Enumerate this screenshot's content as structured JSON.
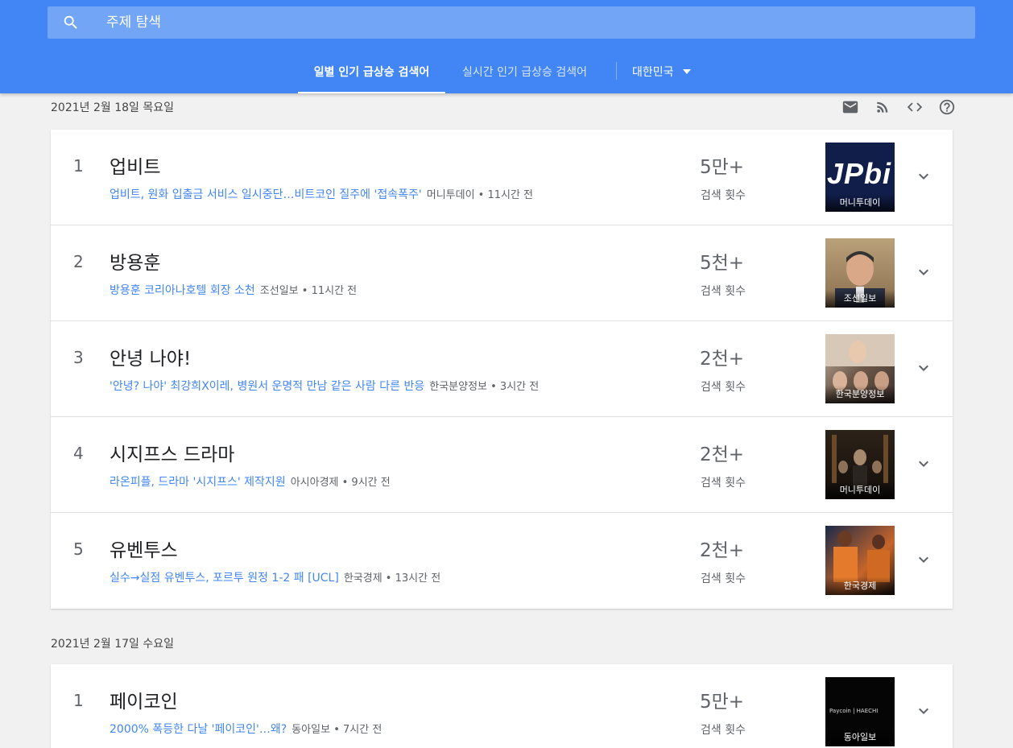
{
  "search": {
    "placeholder": "주제 탐색"
  },
  "tabs": {
    "daily": "일별 인기 급상승 검색어",
    "realtime": "실시간 인기 급상승 검색어"
  },
  "country": "대한민국",
  "days": [
    {
      "date": "2021년 2월 18일 목요일",
      "items": [
        {
          "rank": "1",
          "title": "업비트",
          "news": "업비트, 원화 입출금 서비스 일시중단…비트코인 질주에 '접속폭주'",
          "source": "머니투데이 • 11시간 전",
          "count": "5만+",
          "count_label": "검색 횟수",
          "thumb_caption": "머니투데이",
          "thumb_logo": "JPbi"
        },
        {
          "rank": "2",
          "title": "방용훈",
          "news": "방용훈 코리아나호텔 회장 소천",
          "source": "조선일보 • 11시간 전",
          "count": "5천+",
          "count_label": "검색 횟수",
          "thumb_caption": "조선일보"
        },
        {
          "rank": "3",
          "title": "안녕 나야!",
          "news": "'안녕? 나야' 최강희X이레, 병원서 운명적 만남 같은 사람 다른 반응",
          "source": "한국분양정보 • 3시간 전",
          "count": "2천+",
          "count_label": "검색 횟수",
          "thumb_caption": "한국분양정보"
        },
        {
          "rank": "4",
          "title": "시지프스 드라마",
          "news": "라온피플, 드라마 '시지프스' 제작지원",
          "source": "아시아경제 • 9시간 전",
          "count": "2천+",
          "count_label": "검색 횟수",
          "thumb_caption": "머니투데이"
        },
        {
          "rank": "5",
          "title": "유벤투스",
          "news": "실수→실점 유벤투스, 포르투 원정 1-2 패 [UCL]",
          "source": "한국경제 • 13시간 전",
          "count": "2천+",
          "count_label": "검색 횟수",
          "thumb_caption": "한국경제"
        }
      ]
    },
    {
      "date": "2021년 2월 17일 수요일",
      "items": [
        {
          "rank": "1",
          "title": "페이코인",
          "news": "2000% 폭등한 다날 '페이코인'…왜?",
          "source": "동아일보 • 7시간 전",
          "count": "5만+",
          "count_label": "검색 횟수",
          "thumb_caption": "동아일보",
          "thumb_text": "Paycoin   |   HAECHI"
        }
      ]
    }
  ],
  "colors": {
    "header": "#4285f4",
    "link": "#4285f4",
    "background": "#f1f1f1"
  },
  "icons": {
    "search": "search-icon",
    "email": "email-icon",
    "rss": "rss-icon",
    "embed": "code-icon",
    "help": "help-icon",
    "expand": "chevron-down-icon",
    "dropdown": "arrow-drop-down-icon"
  }
}
